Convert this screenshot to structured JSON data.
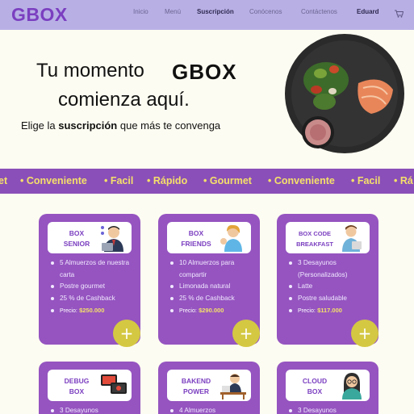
{
  "nav": {
    "logo": "GBOX",
    "links": [
      "Inicio",
      "Menú",
      "Suscripción",
      "Conócenos",
      "Contáctenos",
      "Eduard"
    ],
    "active": "Suscripción",
    "cart_icon": "cart-icon"
  },
  "hero": {
    "line1": "Tu momento",
    "logo": "GBOX",
    "line2": "comienza aquí.",
    "sub_pre": "Elige la",
    "sub_bold": "suscripción",
    "sub_post": "que más te convenga"
  },
  "marquee": {
    "items": [
      "et",
      "• Conveniente",
      "• Facil",
      "• Rápido",
      "• Gourmet",
      "• Conveniente",
      "• Facil",
      "• Rá"
    ]
  },
  "cards": [
    {
      "title_l1": "BOX",
      "title_l2": "SENIOR",
      "features": [
        "5 Almuerzos de nuestra carta",
        "Postre gourmet",
        "25 % de Cashback"
      ],
      "price_label": "Precio:",
      "price": "$250.000"
    },
    {
      "title_l1": "BOX",
      "title_l2": "FRIENDS",
      "features": [
        "10 Almuerzos para compartir",
        "Limonada natural",
        "25 % de Cashback"
      ],
      "price_label": "Precio:",
      "price": "$290.000"
    },
    {
      "title_l1": "BOX CODE",
      "title_l2": "BREAKFAST",
      "features": [
        "3 Desayunos (Personalizados)",
        "Latte",
        "Postre saludable"
      ],
      "price_label": "Precio:",
      "price": "$117.000"
    },
    {
      "title_l1": "DEBUG",
      "title_l2": "BOX",
      "features": [
        "3 Desayunos"
      ]
    },
    {
      "title_l1": "BAKEND",
      "title_l2": "POWER",
      "features": [
        "4 Almuerzos"
      ]
    },
    {
      "title_l1": "CLOUD",
      "title_l2": "BOX",
      "features": [
        "3 Desayunos"
      ]
    }
  ],
  "plus_label": "+",
  "colors": {
    "nav": "#b8b0e5",
    "card": "#9554c0",
    "accent": "#f5e06a",
    "plus": "#d4c842",
    "brand": "#7b3fc0"
  }
}
